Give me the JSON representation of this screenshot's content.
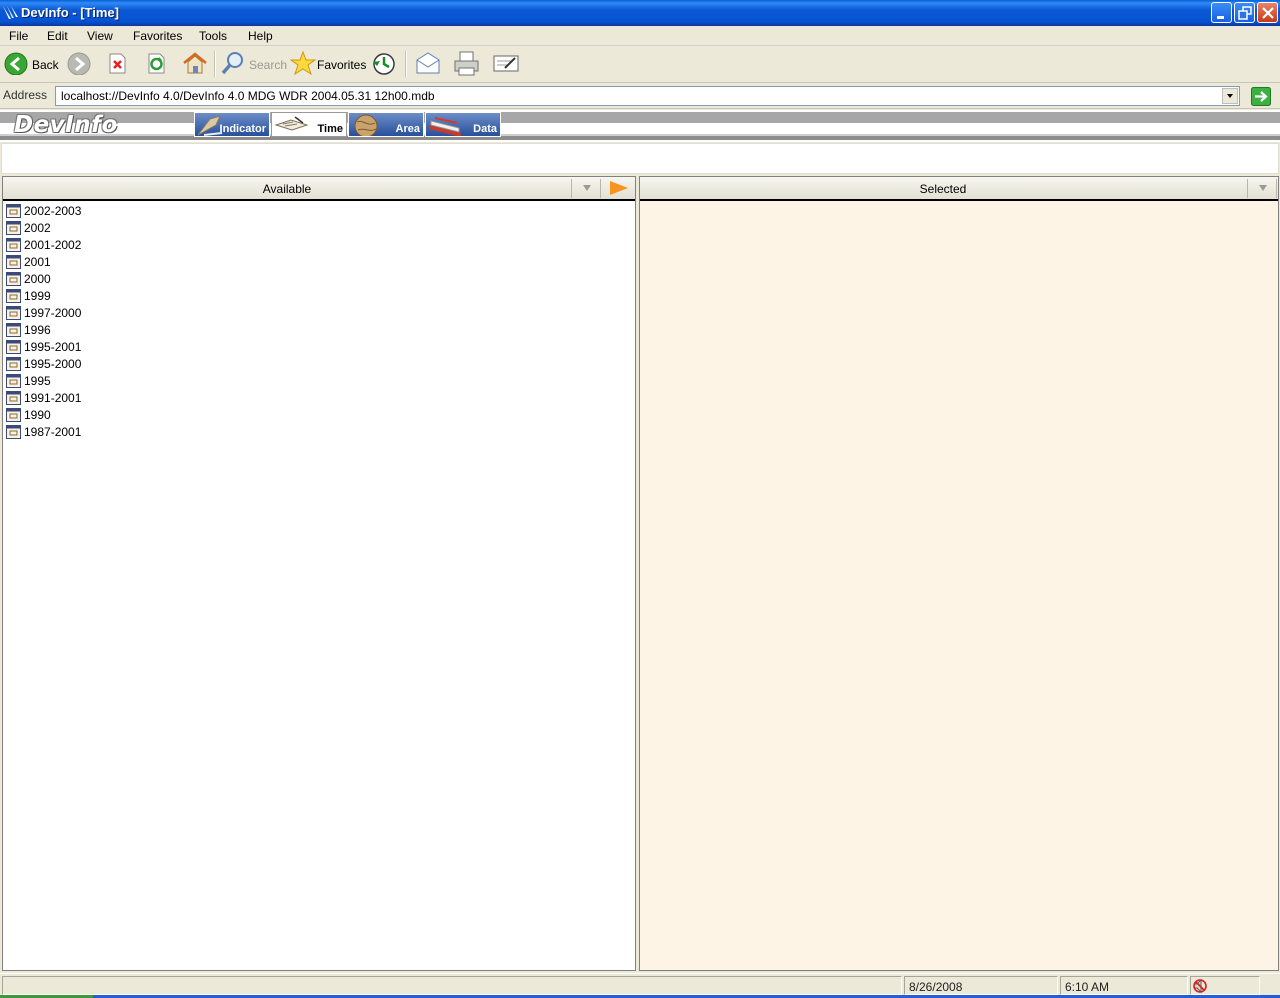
{
  "window": {
    "title": "DevInfo - [Time]"
  },
  "menu": [
    "File",
    "Edit",
    "View",
    "Favorites",
    "Tools",
    "Help"
  ],
  "toolbar": {
    "back_label": "Back",
    "search_label": "Search",
    "favorites_label": "Favorites"
  },
  "address": {
    "label": "Address",
    "value": "localhost://DevInfo 4.0/DevInfo 4.0 MDG WDR 2004.05.31 12h00.mdb"
  },
  "header": {
    "logo": "DevInfo",
    "tabs": [
      {
        "label": "Indicator",
        "active": false
      },
      {
        "label": "Time",
        "active": true
      },
      {
        "label": "Area",
        "active": false
      },
      {
        "label": "Data",
        "active": false
      }
    ]
  },
  "available": {
    "title": "Available",
    "items": [
      "2002-2003",
      "2002",
      "2001-2002",
      "2001",
      "2000",
      "1999",
      "1997-2000",
      "1996",
      "1995-2001",
      "1995-2000",
      "1995",
      "1991-2001",
      "1990",
      "1987-2001"
    ]
  },
  "selected": {
    "title": "Selected",
    "items": []
  },
  "status": {
    "date": "8/26/2008",
    "time": "6:10 AM"
  },
  "colors": {
    "accent_orange": "#f7941d",
    "selected_bg": "#fdf4e5",
    "title_blue": "#0554d3"
  }
}
